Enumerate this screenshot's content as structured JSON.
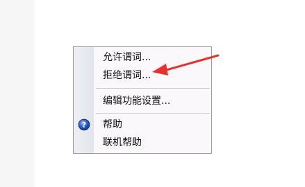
{
  "menu": {
    "items": [
      {
        "label": "允许谓词..."
      },
      {
        "label": "拒绝谓词..."
      },
      {
        "label": "编辑功能设置..."
      },
      {
        "label": "帮助",
        "icon": "help-icon"
      },
      {
        "label": "联机帮助"
      }
    ]
  },
  "annotation": {
    "arrow_color": "#e8312a"
  }
}
